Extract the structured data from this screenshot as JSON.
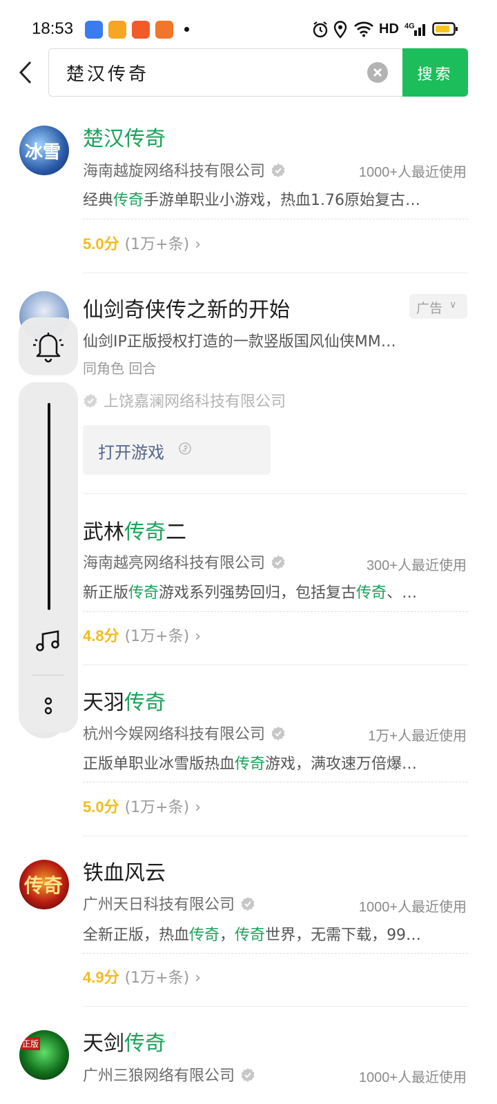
{
  "status_bar": {
    "time": "18:53",
    "network_label": "HD",
    "notification_icons": [
      "baidu-app-icon",
      "video-app-icon",
      "camera-app-icon",
      "game-app-icon"
    ],
    "system_icons": [
      "alarm-icon",
      "location-icon",
      "wifi-icon",
      "signal-4g-icon",
      "battery-icon"
    ]
  },
  "search": {
    "query": "楚汉传奇",
    "button_label": "搜索"
  },
  "colors": {
    "accent_green": "#1cbd5b",
    "highlight_green": "#1aa35a",
    "rating_yellow": "#f3bc19"
  },
  "results": [
    {
      "title_parts": [
        {
          "t": "楚汉传奇",
          "hl": true
        }
      ],
      "company": "海南越旋网络科技有限公司",
      "users": "1000+人最近使用",
      "desc_parts": [
        {
          "t": "经典",
          "hl": false
        },
        {
          "t": "传奇",
          "hl": true
        },
        {
          "t": "手游单职业小游戏，热血1.76原始复古…",
          "hl": false
        }
      ],
      "score": "5.0分",
      "count": "(1万+条)"
    },
    {
      "title_parts": [
        {
          "t": "武林",
          "hl": false
        },
        {
          "t": "传奇",
          "hl": true
        },
        {
          "t": "二",
          "hl": false
        }
      ],
      "company": "海南越亮网络科技有限公司",
      "users": "300+人最近使用",
      "desc_parts": [
        {
          "t": "新正版",
          "hl": false
        },
        {
          "t": "传奇",
          "hl": true
        },
        {
          "t": "游戏系列强势回归，包括复古",
          "hl": false
        },
        {
          "t": "传奇",
          "hl": true
        },
        {
          "t": "、…",
          "hl": false
        }
      ],
      "score": "4.8分",
      "count": "(1万+条)"
    },
    {
      "title_parts": [
        {
          "t": "天羽",
          "hl": false
        },
        {
          "t": "传奇",
          "hl": true
        }
      ],
      "company": "杭州今娱网络科技有限公司",
      "users": "1万+人最近使用",
      "desc_parts": [
        {
          "t": "正版单职业冰雪版热血",
          "hl": false
        },
        {
          "t": "传奇",
          "hl": true
        },
        {
          "t": "游戏，满攻速万倍爆…",
          "hl": false
        }
      ],
      "score": "5.0分",
      "count": "(1万+条)"
    },
    {
      "title_parts": [
        {
          "t": "铁血风云",
          "hl": false
        }
      ],
      "company": "广州天日科技有限公司",
      "users": "1000+人最近使用",
      "desc_parts": [
        {
          "t": "全新正版，热血",
          "hl": false
        },
        {
          "t": "传奇",
          "hl": true
        },
        {
          "t": "，",
          "hl": false
        },
        {
          "t": "传奇",
          "hl": true
        },
        {
          "t": "世界，无需下载，99…",
          "hl": false
        }
      ],
      "score": "4.9分",
      "count": "(1万+条)"
    },
    {
      "title_parts": [
        {
          "t": "天剑",
          "hl": false
        },
        {
          "t": "传奇",
          "hl": true
        }
      ],
      "company": "广州三狼网络有限公司",
      "users": "1000+人最近使用"
    }
  ],
  "ad": {
    "title": "仙剑奇侠传之新的开始",
    "badge": "广告",
    "desc": "仙剑IP正版授权打造的一款竖版国风仙侠MM…",
    "tags": "同角色  回合",
    "company": "上饶嘉澜网络科技有限公司",
    "button_label": "打开游戏"
  },
  "avatar_text": {
    "item1": "冰雪",
    "item5": "传奇",
    "item6": "正版"
  },
  "side_toolbar": {
    "icons": [
      "bell-icon",
      "music-note-icon",
      "more-icon"
    ]
  }
}
